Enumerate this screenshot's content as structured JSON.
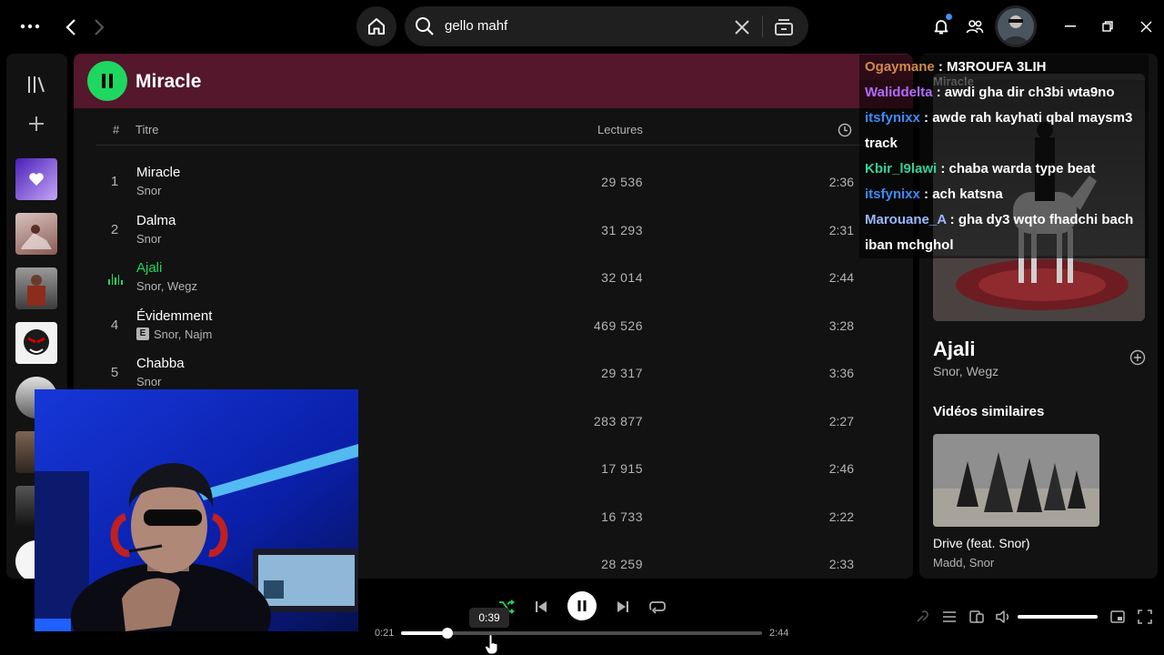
{
  "colors": {
    "accent": "#1ed760",
    "header_bg": "#54172b",
    "panel_bg": "#121212"
  },
  "search": {
    "query": "gello mahf"
  },
  "library": {
    "items": [
      {
        "icon": "liked-songs-heart-icon",
        "color": "#6d3bde"
      },
      {
        "icon": "album-cover",
        "color": "#caa9a3"
      },
      {
        "icon": "album-cover",
        "color": "#7a4a3e"
      },
      {
        "icon": "album-cover",
        "color": "#b02030"
      },
      {
        "icon": "artist-avatar",
        "color": "#c8c8c8"
      },
      {
        "icon": "album-cover",
        "color": "#6a5548"
      },
      {
        "icon": "album-cover",
        "color": "#333333"
      }
    ]
  },
  "playlist": {
    "title": "Miracle",
    "columns": {
      "num": "#",
      "title": "Titre",
      "plays": "Lectures"
    },
    "tracks": [
      {
        "num": "1",
        "title": "Miracle",
        "artist": "Snor",
        "plays": "29 536",
        "duration": "2:36",
        "explicit": false,
        "playing": false
      },
      {
        "num": "2",
        "title": "Dalma",
        "artist": "Snor",
        "plays": "31 293",
        "duration": "2:31",
        "explicit": false,
        "playing": false
      },
      {
        "num": "3",
        "title": "Ajali",
        "artist": "Snor, Wegz",
        "plays": "32 014",
        "duration": "2:44",
        "explicit": false,
        "playing": true
      },
      {
        "num": "4",
        "title": "Évidemment",
        "artist": "Snor, Najm",
        "plays": "469 526",
        "duration": "3:28",
        "explicit": true,
        "playing": false
      },
      {
        "num": "5",
        "title": "Chabba",
        "artist": "Snor",
        "plays": "29 317",
        "duration": "3:36",
        "explicit": false,
        "playing": false
      },
      {
        "num": "",
        "title": "",
        "artist": "",
        "plays": "283 877",
        "duration": "2:27",
        "explicit": false,
        "playing": false
      },
      {
        "num": "",
        "title": "",
        "artist": "",
        "plays": "17 915",
        "duration": "2:46",
        "explicit": false,
        "playing": false
      },
      {
        "num": "",
        "title": "",
        "artist": "",
        "plays": "16 733",
        "duration": "2:22",
        "explicit": false,
        "playing": false
      },
      {
        "num": "",
        "title": "",
        "artist": "",
        "plays": "28 259",
        "duration": "2:33",
        "explicit": false,
        "playing": false
      }
    ]
  },
  "now_playing": {
    "panel_title": "Miracle",
    "title": "Ajali",
    "artist": "Snor, Wegz",
    "similar_heading": "Vidéos similaires",
    "similar": {
      "title": "Drive (feat. Snor)",
      "artist": "Madd, Snor"
    }
  },
  "chat": [
    {
      "user": "Ogaymane",
      "color": "#d08a4a",
      "sep": " : ",
      "text": "M3ROUFA 3LIH"
    },
    {
      "user": "Waliddelta",
      "color": "#b36bff",
      "sep": " : ",
      "text": "awdi gha dir ch3bi wta9no"
    },
    {
      "user": "itsfynixx",
      "color": "#3d8bff",
      "sep": " : ",
      "text": "awde rah kayhati qbal maysm3 track"
    },
    {
      "user": "Kbir_l9lawi",
      "color": "#32d296",
      "sep": " : ",
      "text": "chaba warda type beat"
    },
    {
      "user": "itsfynixx",
      "color": "#3d8bff",
      "sep": " : ",
      "text": "ach katsna"
    },
    {
      "user": "Marouane_A",
      "color": "#9ab8ff",
      "sep": " : ",
      "text": "gha dy3 wqto fhadchi bach iban mchghol"
    }
  ],
  "player": {
    "elapsed": "0:21",
    "total": "2:44",
    "hover_time": "0:39",
    "progress_fraction": 0.128,
    "volume_fraction": 1.0
  }
}
